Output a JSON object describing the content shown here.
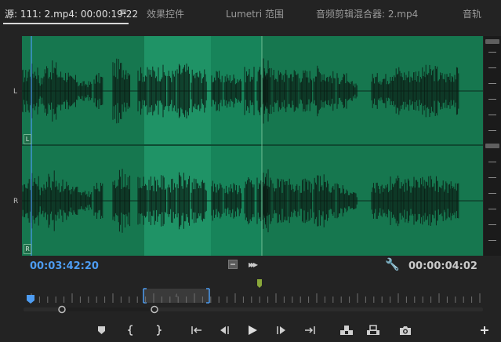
{
  "tabs": {
    "source": "源: 111: 2.mp4: 00:00:19:22",
    "menu_glyph": "≡",
    "effect_controls": "效果控件",
    "lumetri_scopes": "Lumetri 范围",
    "audio_clip_mixer": "音频剪辑混合器: 2.mp4",
    "overflow": "音轨"
  },
  "channels": {
    "left_letter": "L",
    "right_letter": "R",
    "left_tag": "L",
    "right_tag": "R"
  },
  "timecode": {
    "playhead": "00:03:42:20",
    "duration": "00:00:04:02"
  },
  "colors": {
    "waveform_bg": "#16774f",
    "selection_bg": "#1f9366",
    "timecode_blue": "#4d9cf2",
    "marker_green": "#8aa83a"
  },
  "icons": {
    "settings": "wrench-icon",
    "insert": "insert-icon",
    "overwrite": "overwrite-icon",
    "export_frame": "camera-icon",
    "add": "plus-icon"
  }
}
